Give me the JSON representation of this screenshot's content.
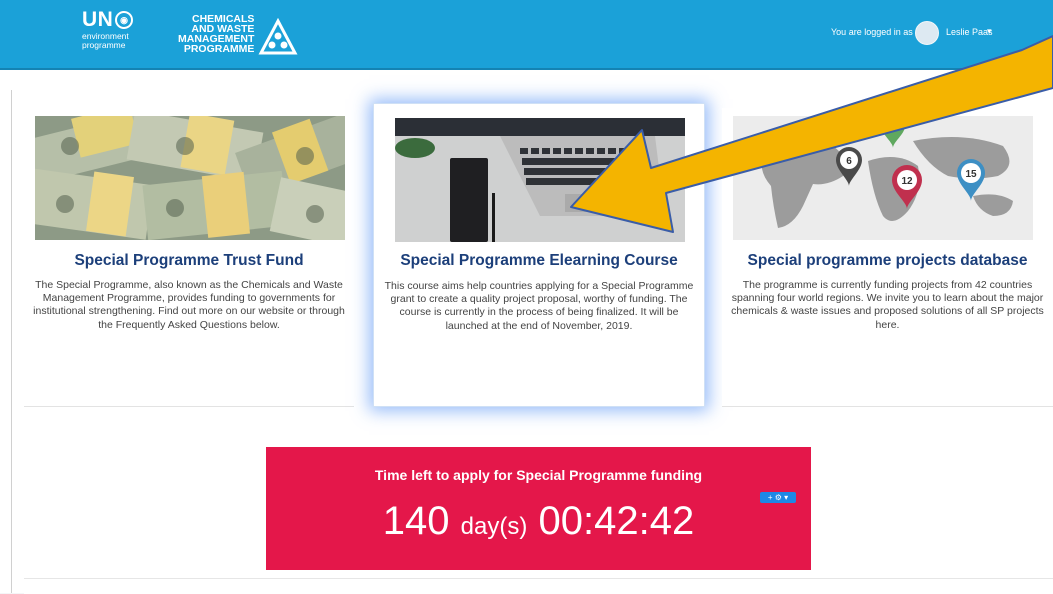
{
  "header": {
    "un_logo": {
      "main": "UN",
      "line1": "environment",
      "line2": "programme"
    },
    "cwm_logo": {
      "line1": "CHEMICALS",
      "line2": "AND WASTE",
      "line3": "MANAGEMENT",
      "line4": "PROGRAMME"
    },
    "user": {
      "logged_in_text": "You are logged in as",
      "name": "Leslie Paas",
      "caret": "▾"
    }
  },
  "cards": [
    {
      "title": "Special Programme Trust Fund",
      "description": "The Special Programme, also known as the Chemicals and Waste Management Programme, provides funding to governments for institutional strengthening. Find out more on our website or through the Frequently Asked Questions below."
    },
    {
      "title": "Special Programme Elearning Course",
      "description": "This course aims help countries applying for a Special Programme grant to create a quality project proposal, worthy of funding. The course is currently in the process of being finalized. It will be launched at the end of November, 2019."
    },
    {
      "title": "Special programme projects database",
      "description": "The programme is currently funding projects from 42 countries spanning four world regions. We invite you to learn about the major chemicals & waste issues and proposed solutions of all SP projects here.",
      "map_markers": [
        "6",
        "12",
        "15"
      ]
    }
  ],
  "countdown": {
    "label": "Time left to apply for Special Programme funding",
    "days": "140",
    "days_unit": "day(s)",
    "clock": "00:42:42",
    "widget_text": "+ ⚙ ▾"
  },
  "colors": {
    "header_bg": "#1ba1d8",
    "title_blue": "#1c3f7a",
    "countdown_bg": "#e4174a",
    "arrow_yellow": "#f4b400",
    "highlight_glow": "#4285f4"
  }
}
